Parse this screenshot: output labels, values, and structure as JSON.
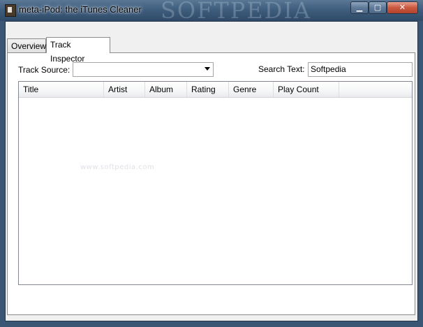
{
  "window": {
    "title": "meta-iPod: the iTunes Cleaner",
    "watermark": "SOFTPEDIA",
    "controls": {
      "minimize": "▁",
      "maximize": "▢",
      "close": "✕"
    }
  },
  "tabs": [
    {
      "label": "Overview",
      "selected": false
    },
    {
      "label": "Track Inspector",
      "selected": true
    }
  ],
  "inspector": {
    "track_source_label": "Track Source:",
    "track_source_value": "",
    "search_label": "Search Text:",
    "search_value": "Softpedia"
  },
  "list": {
    "columns": [
      "Title",
      "Artist",
      "Album",
      "Rating",
      "Genre",
      "Play Count"
    ],
    "rows": [],
    "watermark": "www.softpedia.com"
  },
  "icons": {
    "app": "ipod-app-icon",
    "dropdown": "chevron-down-icon"
  }
}
